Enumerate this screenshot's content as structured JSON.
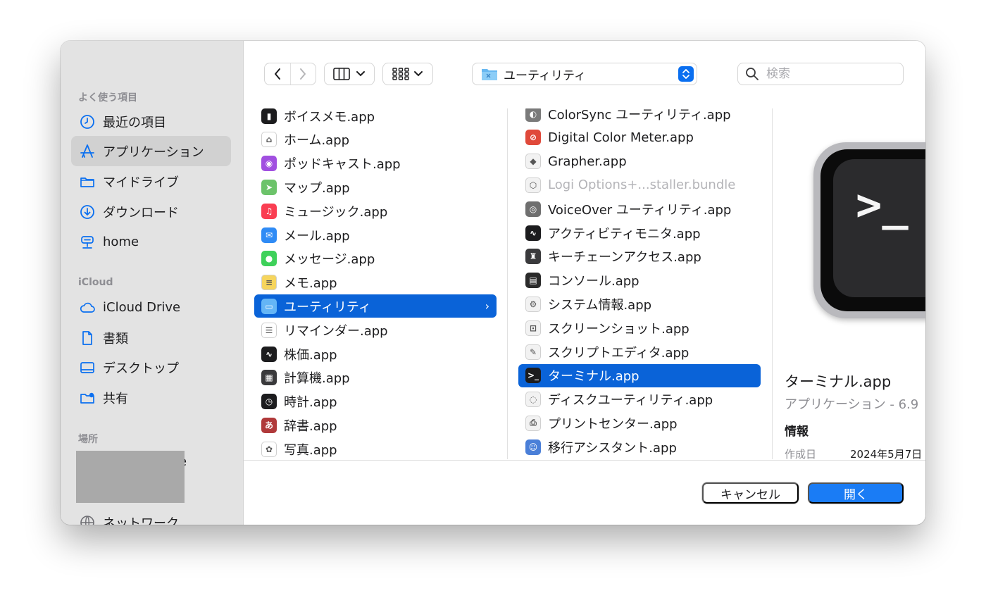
{
  "sidebar": {
    "sections": [
      {
        "title": "よく使う項目"
      },
      {
        "title": "iCloud"
      },
      {
        "title": "場所"
      }
    ],
    "favorites": [
      {
        "label": "最近の項目",
        "icon": "clock-icon"
      },
      {
        "label": "アプリケーション",
        "icon": "apps-icon"
      },
      {
        "label": "マイドライブ",
        "icon": "folder-icon"
      },
      {
        "label": "ダウンロード",
        "icon": "download-icon"
      },
      {
        "label": "home",
        "icon": "server-icon"
      }
    ],
    "icloud": [
      {
        "label": "iCloud Drive",
        "icon": "cloud-icon"
      },
      {
        "label": "書類",
        "icon": "document-icon"
      },
      {
        "label": "デスクトップ",
        "icon": "desktop-icon"
      },
      {
        "label": "共有",
        "icon": "shared-folder-icon"
      }
    ],
    "places_tail": "e",
    "network": {
      "label": "ネットワーク",
      "icon": "globe-icon"
    }
  },
  "toolbar": {
    "back": "‹",
    "forward": "›",
    "path_label": "ユーティリティ",
    "search_placeholder": "検索"
  },
  "column1": [
    {
      "label": "ボイスメモ.app",
      "color": "#1c1c1e",
      "glyph": "▮"
    },
    {
      "label": "ホーム.app",
      "color": "#ffffff",
      "glyph": "⌂"
    },
    {
      "label": "ポッドキャスト.app",
      "color": "#a14fe0",
      "glyph": "◉"
    },
    {
      "label": "マップ.app",
      "color": "#6cc36a",
      "glyph": "➤"
    },
    {
      "label": "ミュージック.app",
      "color": "#fa3e52",
      "glyph": "♫"
    },
    {
      "label": "メール.app",
      "color": "#2f8bf5",
      "glyph": "✉"
    },
    {
      "label": "メッセージ.app",
      "color": "#3ed15a",
      "glyph": "●"
    },
    {
      "label": "メモ.app",
      "color": "#f6d55d",
      "glyph": "≡"
    },
    {
      "label": "ユーティリティ",
      "color": "#64b5f6",
      "glyph": "▭",
      "selected": true
    },
    {
      "label": "リマインダー.app",
      "color": "#ffffff",
      "glyph": "☰"
    },
    {
      "label": "株価.app",
      "color": "#1c1c1e",
      "glyph": "∿"
    },
    {
      "label": "計算機.app",
      "color": "#3a3a3c",
      "glyph": "▦"
    },
    {
      "label": "時計.app",
      "color": "#1c1c1e",
      "glyph": "◷"
    },
    {
      "label": "辞書.app",
      "color": "#b0393a",
      "glyph": "あ"
    },
    {
      "label": "写真.app",
      "color": "#ffffff",
      "glyph": "✿"
    }
  ],
  "column2": [
    {
      "label": "ColorSync ユーティリティ.app",
      "color": "#7a7a7a",
      "glyph": "◐"
    },
    {
      "label": "Digital Color Meter.app",
      "color": "#e0493a",
      "glyph": "⊘"
    },
    {
      "label": "Grapher.app",
      "color": "#f2f2f2",
      "glyph": "◆"
    },
    {
      "label": "Logi Options+...staller.bundle",
      "color": "#f2f2f2",
      "glyph": "⬡",
      "dim": true
    },
    {
      "label": "VoiceOver ユーティリティ.app",
      "color": "#6f6f6f",
      "glyph": "◎"
    },
    {
      "label": "アクティビティモニタ.app",
      "color": "#1c1c1e",
      "glyph": "∿"
    },
    {
      "label": "キーチェーンアクセス.app",
      "color": "#3a3a3c",
      "glyph": "♜"
    },
    {
      "label": "コンソール.app",
      "color": "#2a2a2a",
      "glyph": "▤"
    },
    {
      "label": "システム情報.app",
      "color": "#f2f2f2",
      "glyph": "⚙"
    },
    {
      "label": "スクリーンショット.app",
      "color": "#f2f2f2",
      "glyph": "⊡"
    },
    {
      "label": "スクリプトエディタ.app",
      "color": "#f2f2f2",
      "glyph": "✎"
    },
    {
      "label": "ターミナル.app",
      "color": "#1c1c1e",
      "glyph": ">_",
      "selected": true
    },
    {
      "label": "ディスクユーティリティ.app",
      "color": "#f2f2f2",
      "glyph": "◌"
    },
    {
      "label": "プリントセンター.app",
      "color": "#f2f2f2",
      "glyph": "⎙"
    },
    {
      "label": "移行アシスタント.app",
      "color": "#4a7fd8",
      "glyph": "☺"
    }
  ],
  "preview": {
    "prompt": ">_",
    "name": "ターミナル.app",
    "kind": "アプリケーション - 6.9",
    "info_heading": "情報",
    "created_label": "作成日",
    "created_value": "2024年5月7日"
  },
  "footer": {
    "cancel": "キャンセル",
    "open": "開く"
  },
  "colors": {
    "accent": "#0a63d8",
    "open_button": "#1a7cf5",
    "sidebar_bg": "#e3e3e3"
  }
}
